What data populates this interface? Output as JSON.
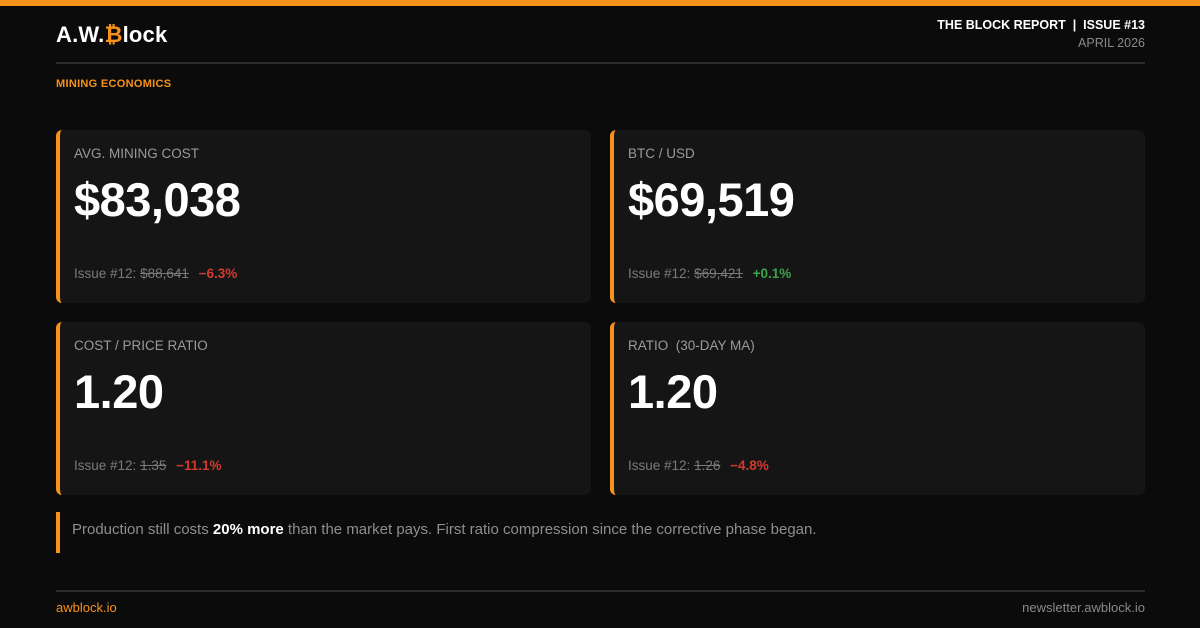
{
  "brand": {
    "logo_prefix": "A.W.",
    "logo_btc": "₿",
    "logo_suffix": "lock",
    "accent_color": "#f7931a"
  },
  "header": {
    "report_title": "THE BLOCK REPORT  |  ISSUE #13",
    "date": "APRIL 2026"
  },
  "section_label": "MINING ECONOMICS",
  "cards": [
    {
      "label": "AVG. MINING COST",
      "value": "$83,038",
      "prev_label": "Issue #12:",
      "prev_value": "$88,641",
      "change": "−6.3%",
      "change_direction": "negative"
    },
    {
      "label": "BTC / USD",
      "value": "$69,519",
      "prev_label": "Issue #12:",
      "prev_value": "$69,421",
      "change": "+0.1%",
      "change_direction": "positive"
    },
    {
      "label": "COST / PRICE RATIO",
      "value": "1.20",
      "prev_label": "Issue #12:",
      "prev_value": "1.35",
      "change": "−11.1%",
      "change_direction": "negative"
    },
    {
      "label": "RATIO  (30-DAY MA)",
      "value": "1.20",
      "prev_label": "Issue #12:",
      "prev_value": "1.26",
      "change": "−4.8%",
      "change_direction": "negative"
    }
  ],
  "note": {
    "before": "Production still costs ",
    "emphasis": "20% more",
    "after": " than the market pays. First ratio compression since the corrective phase began."
  },
  "footer": {
    "left": "awblock.io",
    "right": "newsletter.awblock.io"
  },
  "colors": {
    "negative": "#d13a2f",
    "positive": "#3aa44a",
    "background": "#0b0b0b",
    "card": "#151515"
  }
}
